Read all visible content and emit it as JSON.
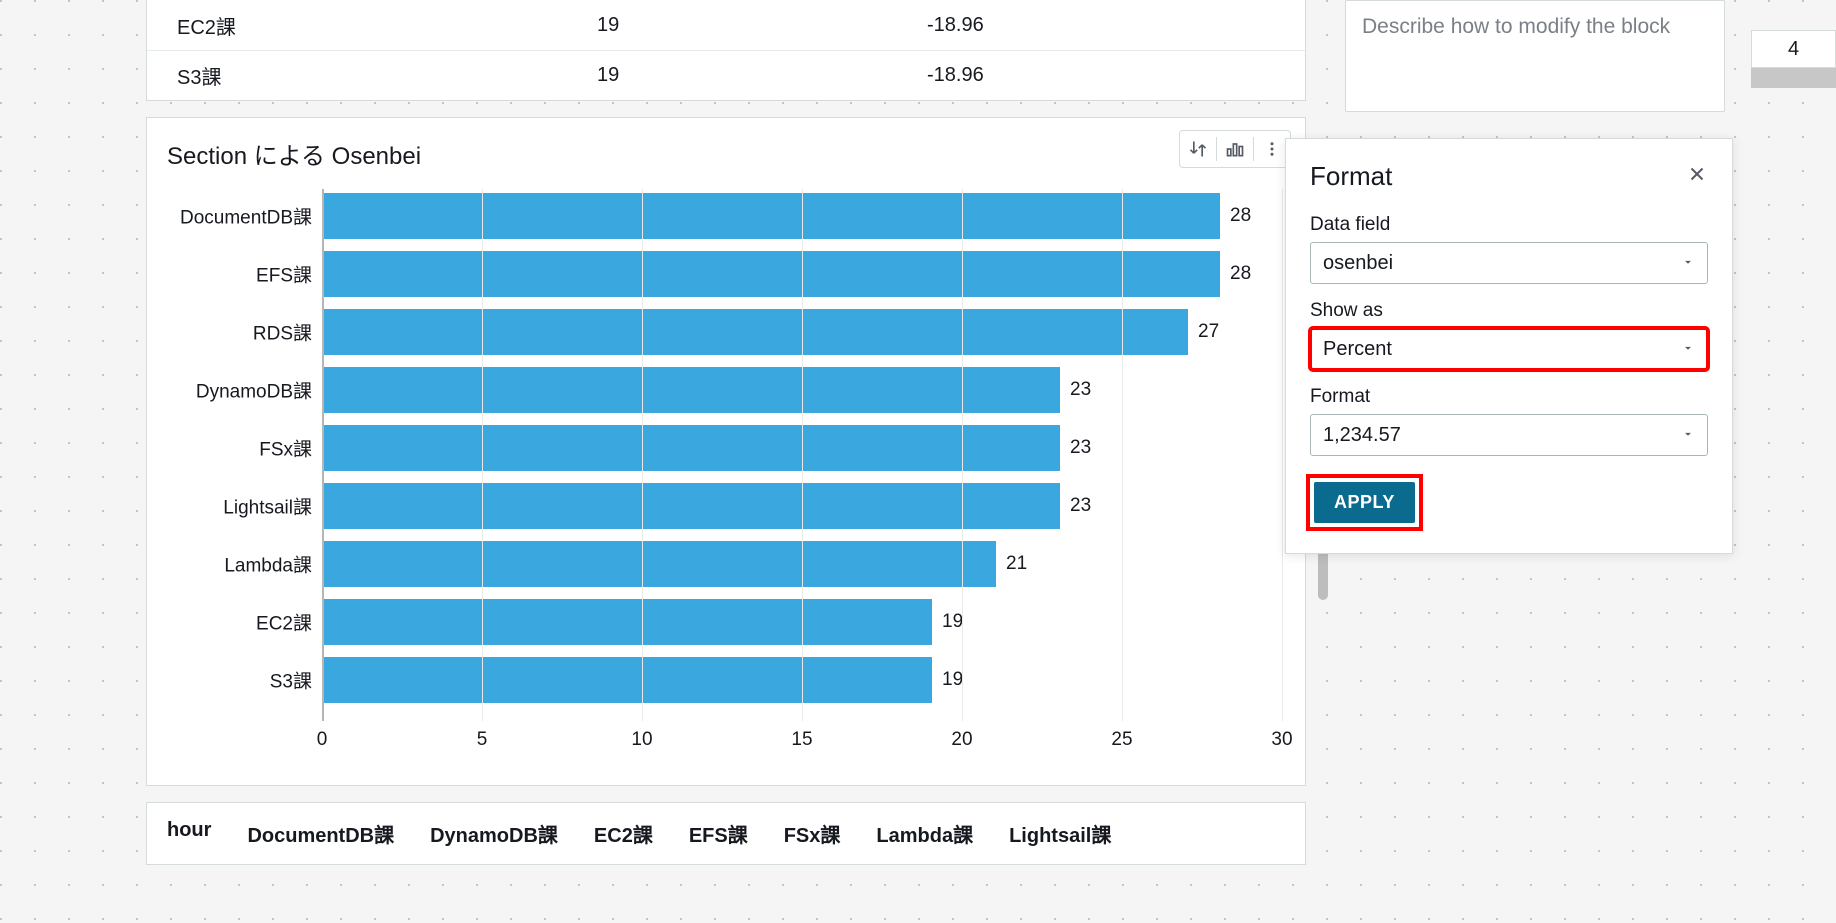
{
  "table_top": {
    "rows": [
      {
        "c1": "EC2課",
        "c2": "19",
        "c3": "-18.96"
      },
      {
        "c1": "S3課",
        "c2": "19",
        "c3": "-18.96"
      }
    ]
  },
  "chart": {
    "title": "Section による Osenbei"
  },
  "chart_data": {
    "type": "bar",
    "orientation": "horizontal",
    "categories": [
      "DocumentDB課",
      "EFS課",
      "RDS課",
      "DynamoDB課",
      "FSx課",
      "Lightsail課",
      "Lambda課",
      "EC2課",
      "S3課"
    ],
    "values": [
      28,
      28,
      27,
      23,
      23,
      23,
      21,
      19,
      19
    ],
    "xticks": [
      0,
      5,
      10,
      15,
      20,
      25,
      30
    ],
    "xlim": [
      0,
      30
    ],
    "title": "Section による Osenbei",
    "xlabel": "",
    "ylabel": ""
  },
  "pivot_headers": [
    "hour",
    "DocumentDB課",
    "DynamoDB課",
    "EC2課",
    "EFS課",
    "FSx課",
    "Lambda課",
    "Lightsail課"
  ],
  "describe_placeholder": "Describe how to modify the block",
  "format_panel": {
    "title": "Format",
    "data_field_label": "Data field",
    "data_field_value": "osenbei",
    "show_as_label": "Show as",
    "show_as_value": "Percent",
    "format_label": "Format",
    "format_value": "1,234.57",
    "apply_label": "APPLY"
  },
  "side_tab": "4"
}
